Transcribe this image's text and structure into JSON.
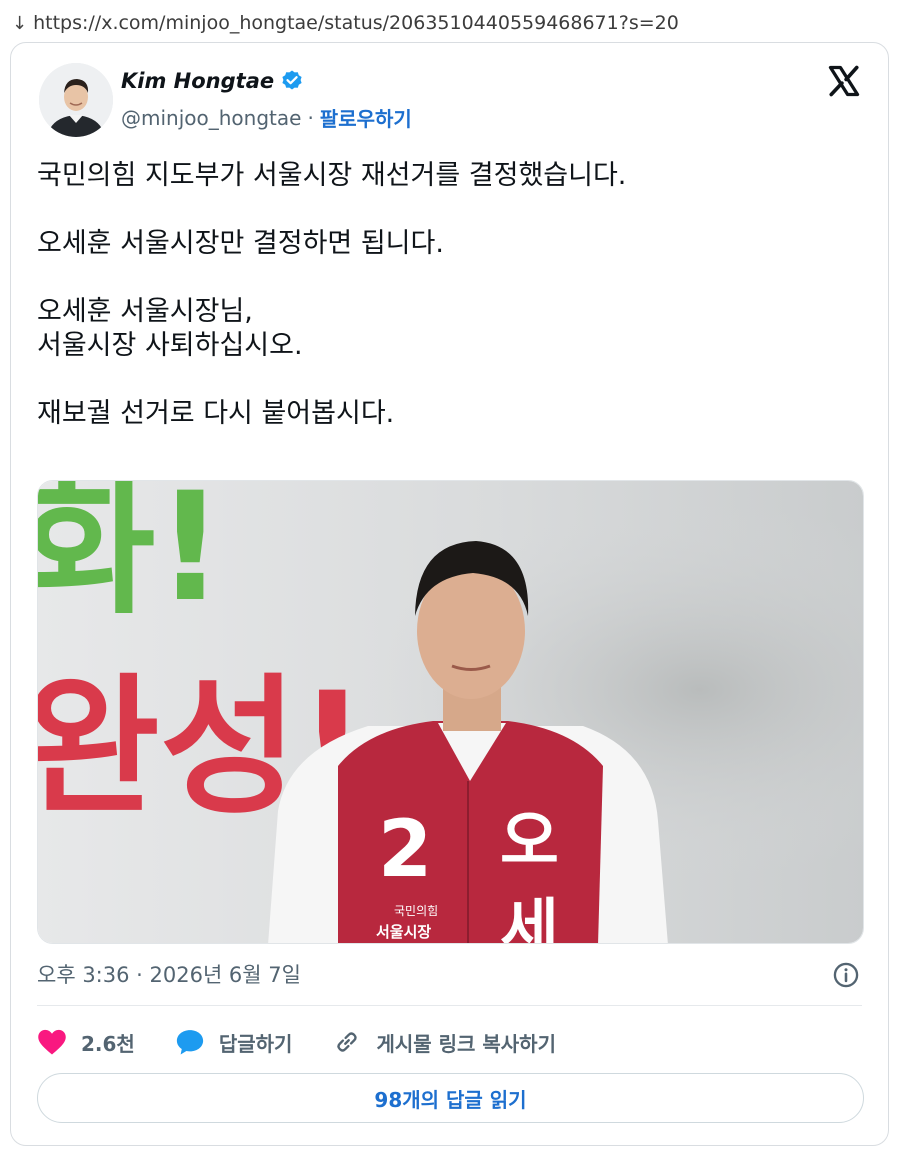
{
  "browser": {
    "arrow_glyph": "↓",
    "url": "https://x.com/minjoo_hongtae/status/2063510440559468671?s=20"
  },
  "tweet": {
    "author_name": "Kim Hongtae",
    "handle": "@minjoo_hongtae",
    "separator": "·",
    "follow_label": "팔로우하기",
    "text": "국민의힘 지도부가 서울시장 재선거를 결정했습니다.\n\n오세훈 서울시장만 결정하면 됩니다.\n\n오세훈 서울시장님,\n서울시장 사퇴하십시오.\n\n재보궐 선거로 다시 붙어봅시다.",
    "timestamp": "오후 3:36 · 2026년 6월 7일",
    "media": {
      "banner_top": "화!",
      "banner_bottom": "완성!",
      "vest_number": "2",
      "vest_char_1": "오",
      "vest_char_2": "세",
      "vest_party": "국민의힘",
      "vest_role": "서울시장"
    }
  },
  "actions": {
    "likes": "2.6천",
    "reply_label": "답글하기",
    "copy_link_label": "게시물 링크 복사하기",
    "read_replies_label": "98개의 답글 읽기"
  },
  "colors": {
    "accent": "#1d6fcf",
    "heart": "#f91880",
    "reply_bubble": "#1d9bf0",
    "vest_red": "#b8283e",
    "banner_green": "#62b84d",
    "banner_red": "#d93a4b"
  },
  "icons": {
    "verified": "verified-badge-icon",
    "x": "x-logo-icon",
    "info": "info-icon",
    "like": "heart-icon",
    "reply": "speech-bubble-icon",
    "link": "link-icon"
  }
}
